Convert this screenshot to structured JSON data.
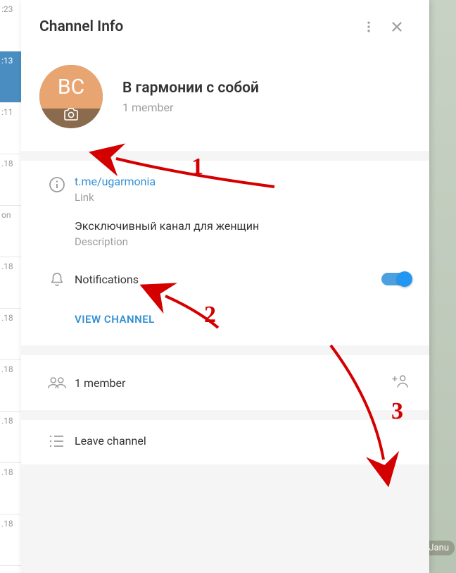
{
  "header": {
    "title": "Channel Info"
  },
  "profile": {
    "avatar_initials": "BC",
    "channel_name": "В гармонии с собой",
    "member_text": "1 member"
  },
  "link_section": {
    "link": "t.me/ugarmonia",
    "link_label": "Link",
    "description": "Эксключивный канал для женщин",
    "description_label": "Description"
  },
  "notifications": {
    "label": "Notifications",
    "enabled": true
  },
  "actions": {
    "view_channel": "VIEW CHANNEL"
  },
  "members": {
    "count_text": "1 member"
  },
  "leave": {
    "label": "Leave channel"
  },
  "background": {
    "date_pill": "Janu",
    "left_list": [
      ":23",
      ":13",
      ":11",
      ".18",
      "on",
      ".18",
      ".18",
      ".18",
      ".18",
      ".18",
      ".18"
    ]
  },
  "annotations": {
    "one": "1",
    "two": "2",
    "three": "3"
  }
}
